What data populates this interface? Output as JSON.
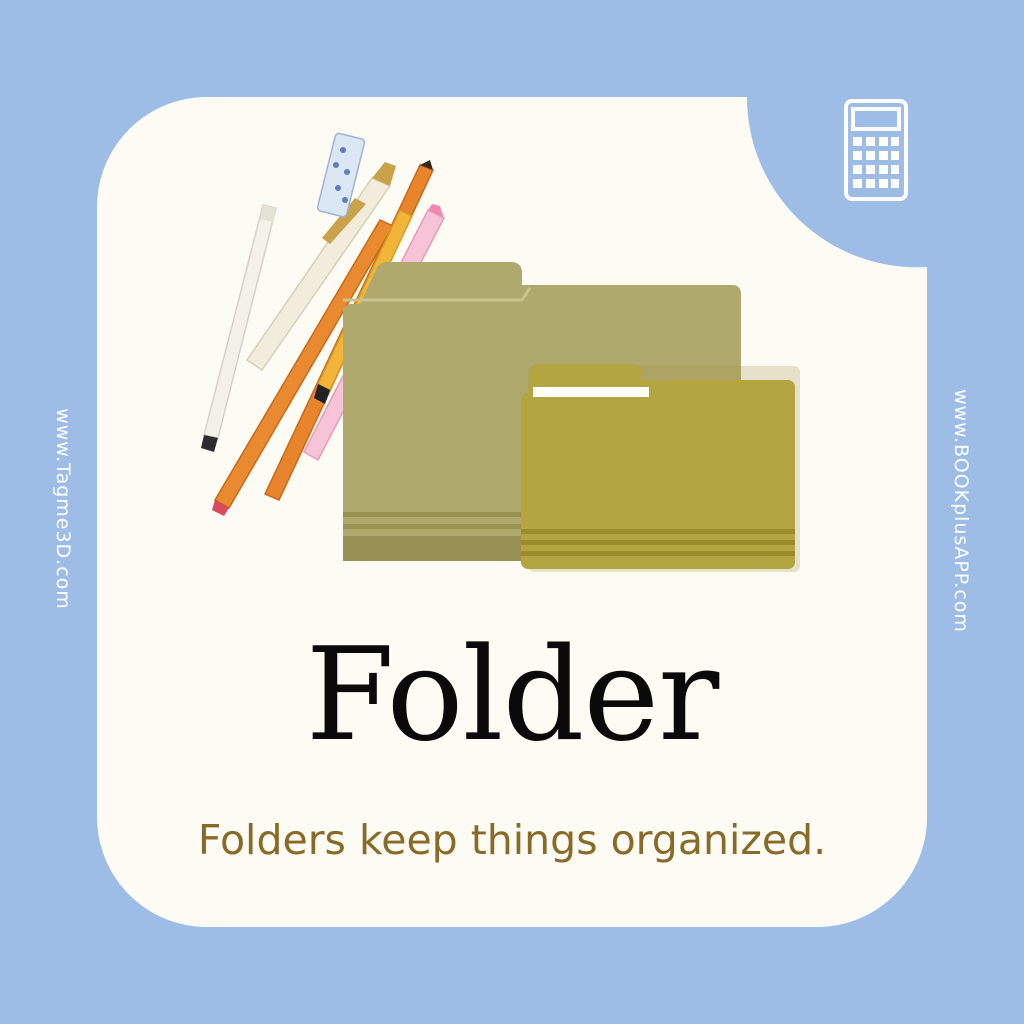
{
  "card": {
    "title": "Folder",
    "subtitle": "Folders keep things organized."
  },
  "side_text": {
    "left": "www.Tagme3D.com",
    "right": "www.BOOKplusAPP.com"
  },
  "icons": {
    "corner": "calculator-icon",
    "illustration": "folders-and-pencils-illustration"
  },
  "colors": {
    "background": "#9dbce6",
    "card": "#fdfcf4",
    "folder_back": "#b0a96e",
    "folder_front": "#b3a540",
    "subtitle": "#8a6a28",
    "title": "#0a0a0a"
  }
}
